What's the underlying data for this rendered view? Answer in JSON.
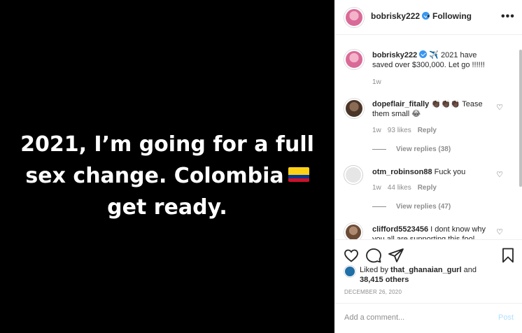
{
  "media": {
    "lines": [
      "2021, I’m going for a full",
      "sex change. Colombia",
      "get ready."
    ],
    "flag_colors": [
      "#fcd116",
      "#003893",
      "#ce1126"
    ]
  },
  "header": {
    "username": "bobrisky222",
    "separator": "•",
    "following": "Following",
    "more": "•••"
  },
  "caption": {
    "username": "bobrisky222",
    "text": "✈️ 2021 have saved over $300,000. Let go !!!!!!",
    "time": "1w"
  },
  "comments": [
    {
      "username": "dopeflair_fitally",
      "text": "👏🏿👏🏿👏🏿 Tease them small 😂",
      "time": "1w",
      "likes": "93 likes",
      "reply": "Reply",
      "view_replies": "View replies (38)"
    },
    {
      "username": "otm_robinson88",
      "text": "Fuck you",
      "time": "1w",
      "likes": "44 likes",
      "reply": "Reply",
      "view_replies": "View replies (47)"
    },
    {
      "username": "clifford5523456",
      "text": "I dont know why you all are supporting this fool"
    }
  ],
  "likes": {
    "prefix": "Liked by",
    "user": "that_ghanaian_gurl",
    "and": "and",
    "others": "38,415 others"
  },
  "date": "DECEMBER 26, 2020",
  "add_comment": {
    "placeholder": "Add a comment...",
    "post": "Post"
  },
  "colors": {
    "verified": "#3897f0",
    "muted": "#8e8e8e",
    "post": "#b2dffc"
  }
}
